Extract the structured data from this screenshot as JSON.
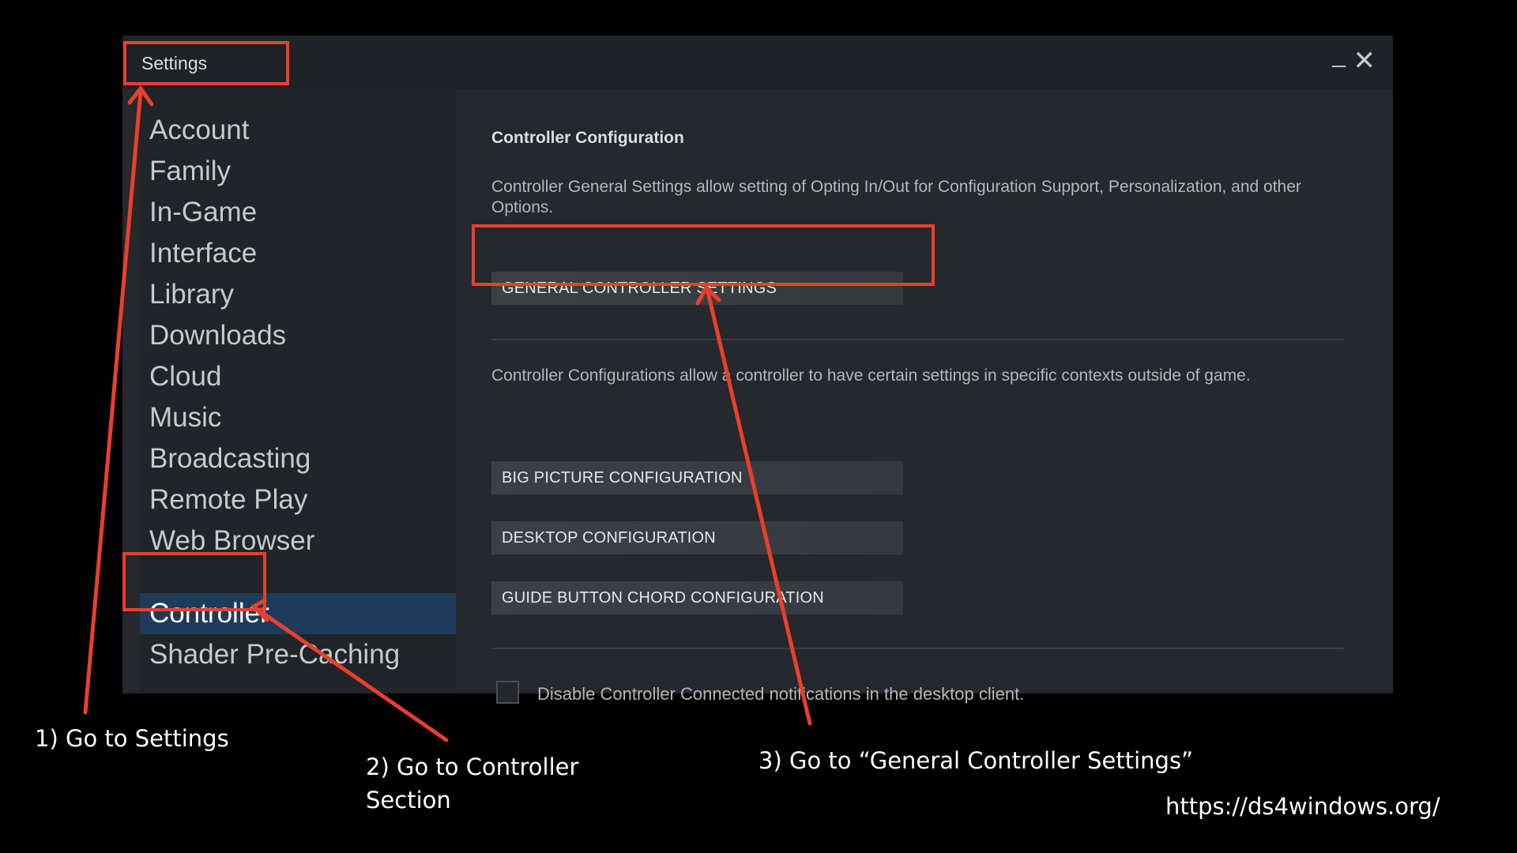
{
  "window": {
    "title": "Settings",
    "minimize_symbol": "_",
    "close_symbol": "✕"
  },
  "sidebar": {
    "items": [
      {
        "label": "Account"
      },
      {
        "label": "Family"
      },
      {
        "label": "In-Game"
      },
      {
        "label": "Interface"
      },
      {
        "label": "Library"
      },
      {
        "label": "Downloads"
      },
      {
        "label": "Cloud"
      },
      {
        "label": "Music"
      },
      {
        "label": "Broadcasting"
      },
      {
        "label": "Remote Play"
      },
      {
        "label": "Web Browser"
      },
      {
        "label": "Controller"
      },
      {
        "label": "Shader Pre-Caching"
      }
    ],
    "active": "Controller"
  },
  "content": {
    "title": "Controller Configuration",
    "general_desc": "Controller General Settings allow setting of Opting In/Out for Configuration Support, Personalization, and other Options.",
    "general_button": "GENERAL CONTROLLER SETTINGS",
    "config_desc": "Controller Configurations allow a controller to have certain settings in specific contexts outside of game.",
    "big_picture_button": "BIG PICTURE CONFIGURATION",
    "desktop_button": "DESKTOP CONFIGURATION",
    "guide_button": "GUIDE BUTTON CHORD CONFIGURATION",
    "checkbox_label": "Disable Controller Connected notifications in the desktop client.",
    "checkbox_checked": false
  },
  "annotations": {
    "step1": "1) Go to Settings",
    "step2_line1": "2) Go to Controller",
    "step2_line2": "Section",
    "step3": "3) Go to “General Controller Settings”",
    "url": "https://ds4windows.org/",
    "highlight_color": "#e8402e"
  }
}
